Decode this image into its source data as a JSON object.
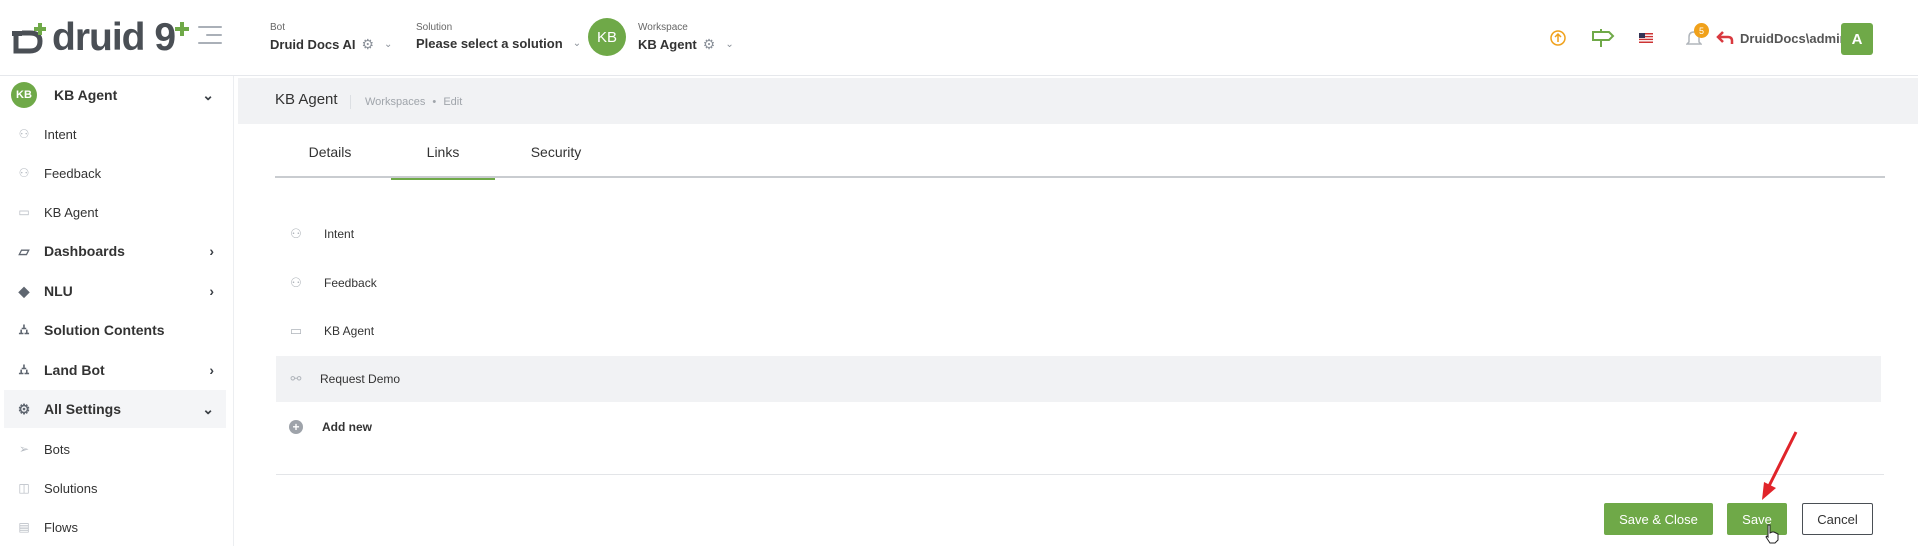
{
  "brand": {
    "logo_text": "druid",
    "logo_suffix": "9",
    "accent": "#6fa948"
  },
  "header": {
    "bot": {
      "caption": "Bot",
      "value": "Druid Docs AI"
    },
    "solution": {
      "caption": "Solution",
      "value": "Please select a solution"
    },
    "workspace": {
      "avatar": "KB",
      "caption": "Workspace",
      "value": "KB Agent"
    },
    "notifications_count": "5",
    "user": {
      "name": "DruidDocs\\admin",
      "avatar": "A"
    }
  },
  "sidebar": {
    "workspace": {
      "avatar": "KB",
      "label": "KB Agent"
    },
    "items": [
      {
        "label": "Intent",
        "icon": "intent-icon"
      },
      {
        "label": "Feedback",
        "icon": "feedback-icon"
      },
      {
        "label": "KB Agent",
        "icon": "kb-agent-icon"
      },
      {
        "label": "Dashboards",
        "icon": "dashboard-icon"
      },
      {
        "label": "NLU",
        "icon": "nlu-icon"
      },
      {
        "label": "Solution Contents",
        "icon": "solution-contents-icon"
      },
      {
        "label": "Land Bot",
        "icon": "land-bot-icon"
      },
      {
        "label": "All Settings",
        "icon": "settings-icon"
      },
      {
        "label": "Bots",
        "icon": "bots-icon"
      },
      {
        "label": "Solutions",
        "icon": "solutions-icon"
      },
      {
        "label": "Flows",
        "icon": "flows-icon"
      }
    ]
  },
  "page": {
    "title": "KB Agent",
    "breadcrumb": [
      "Workspaces",
      "Edit"
    ],
    "tabs": [
      "Details",
      "Links",
      "Security"
    ],
    "active_tab": "Links"
  },
  "links": {
    "rows": [
      {
        "label": "Intent",
        "icon": "intent-icon"
      },
      {
        "label": "Feedback",
        "icon": "feedback-icon"
      },
      {
        "label": "KB Agent",
        "icon": "kb-agent-icon"
      },
      {
        "label": "Request Demo",
        "icon": "link-icon"
      }
    ],
    "add_new": "Add new"
  },
  "actions": {
    "save_close": "Save & Close",
    "save": "Save",
    "cancel": "Cancel"
  }
}
